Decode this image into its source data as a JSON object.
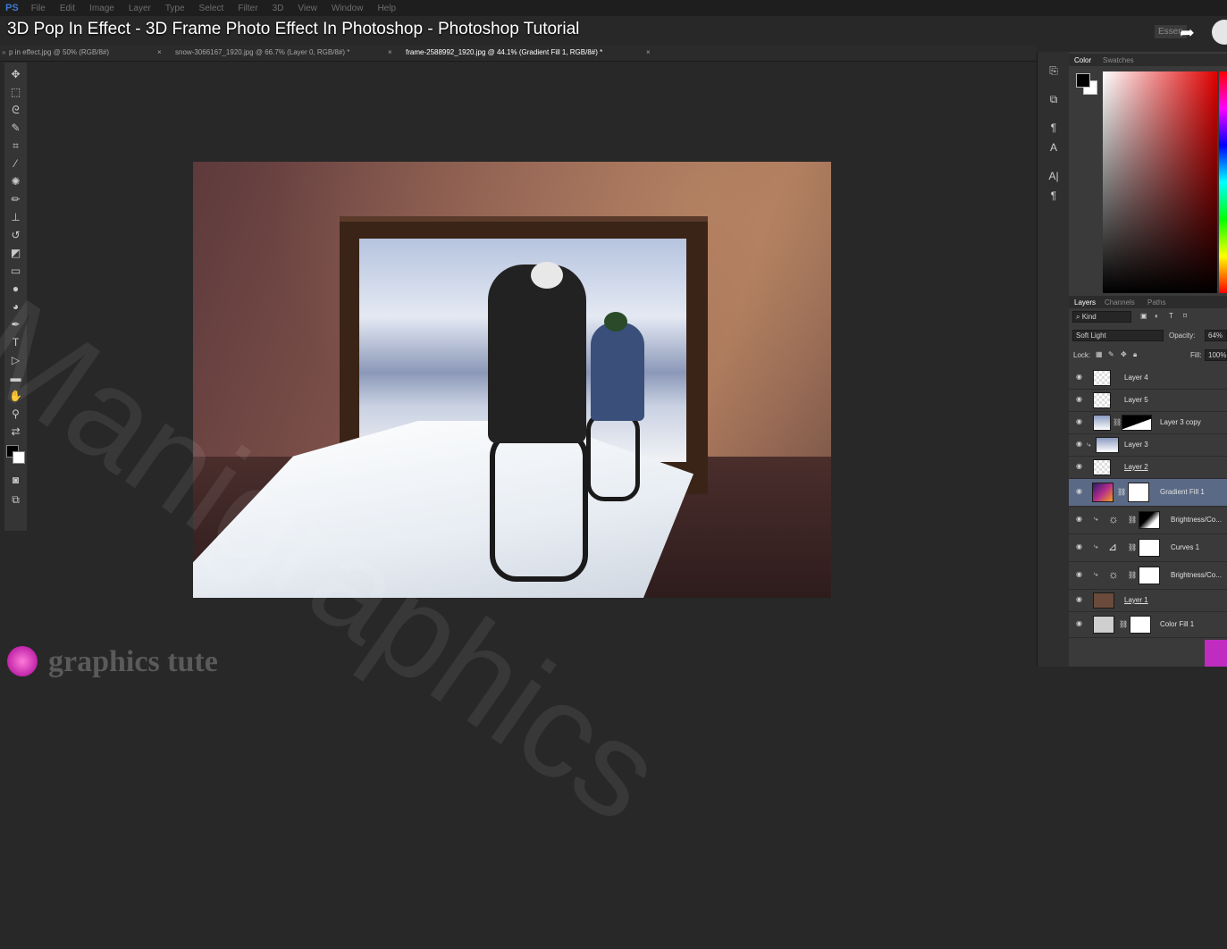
{
  "menu": {
    "app_logo": "PS",
    "items": [
      "File",
      "Edit",
      "Image",
      "Layer",
      "Type",
      "Select",
      "Filter",
      "3D",
      "View",
      "Window",
      "Help"
    ]
  },
  "video_title": "3D Pop In Effect - 3D Frame Photo Effect In Photoshop - Photoshop Tutorial",
  "workspace_label": "Essen",
  "tabs": [
    {
      "label": "p in effect.jpg @ 50% (RGB/8#)"
    },
    {
      "label": "snow-3066167_1920.jpg @ 66.7% (Layer 0, RGB/8#) *"
    },
    {
      "label": "frame-2588992_1920.jpg @ 44.1% (Gradient Fill 1, RGB/8#) *"
    }
  ],
  "tab_close": "×",
  "color_panel": {
    "tabs": [
      "Color",
      "Swatches"
    ]
  },
  "layers_panel": {
    "tabs": [
      "Layers",
      "Channels",
      "Paths"
    ],
    "kind_label": "Kind",
    "blend_mode": "Soft Light",
    "opacity_label": "Opacity:",
    "opacity_value": "64%",
    "lock_label": "Lock:",
    "fill_label": "Fill:",
    "fill_value": "100%",
    "layers": [
      {
        "name": "Layer 4"
      },
      {
        "name": "Layer 5"
      },
      {
        "name": "Layer 3 copy"
      },
      {
        "name": "Layer 3"
      },
      {
        "name": "Layer 2"
      },
      {
        "name": "Gradient Fill 1"
      },
      {
        "name": "Brightness/Co..."
      },
      {
        "name": "Curves 1"
      },
      {
        "name": "Brightness/Co..."
      },
      {
        "name": "Layer 1"
      },
      {
        "name": "Color Fill 1"
      }
    ]
  },
  "logo_text": "graphics tute",
  "watermark": "Manigraphics"
}
